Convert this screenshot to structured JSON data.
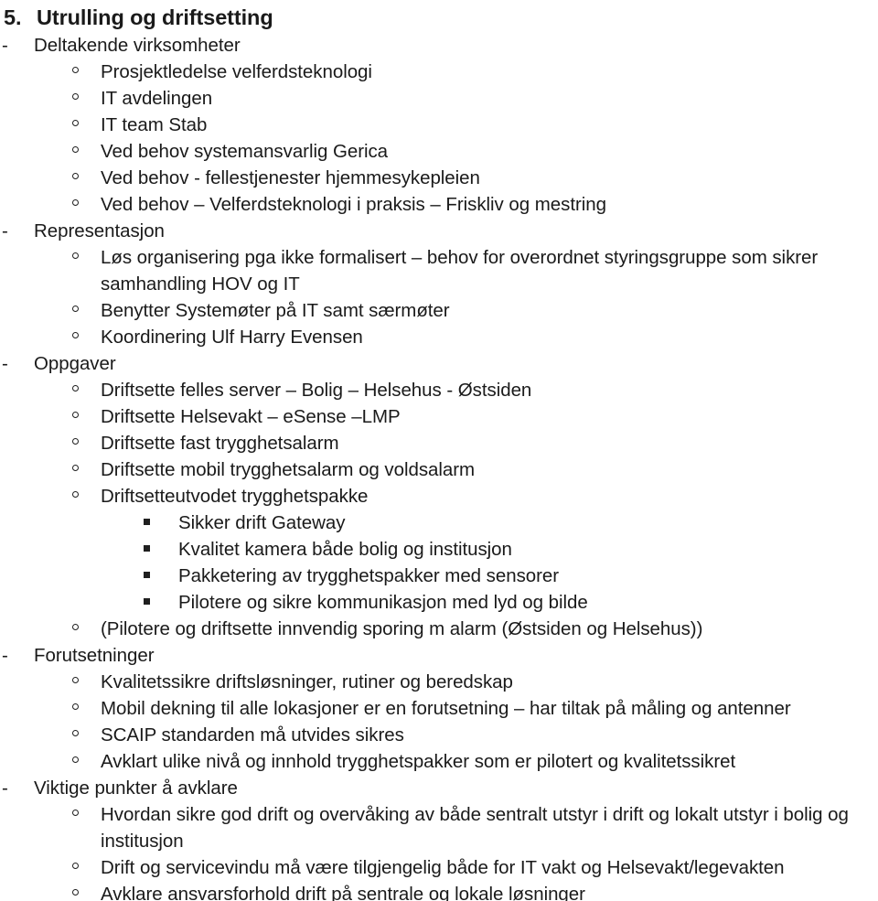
{
  "document": {
    "background_color": "#ffffff",
    "text_color": "#1a1a1a",
    "heading": {
      "number": "5.",
      "title": "Utrulling og driftsetting"
    },
    "markers": {
      "dash": "-",
      "circle": "o",
      "square": "▪"
    },
    "sections": [
      {
        "marker": "dash",
        "label": "Deltakende virksomheter",
        "children": [
          {
            "marker": "circle",
            "label": "Prosjektledelse velferdsteknologi"
          },
          {
            "marker": "circle",
            "label": "IT avdelingen"
          },
          {
            "marker": "circle",
            "label": "IT team Stab"
          },
          {
            "marker": "circle",
            "label": "Ved behov systemansvarlig Gerica"
          },
          {
            "marker": "circle",
            "label": "Ved behov  - fellestjenester hjemmesykepleien"
          },
          {
            "marker": "circle",
            "label": "Ved behov – Velferdsteknologi i praksis – Friskliv og mestring"
          }
        ]
      },
      {
        "marker": "dash",
        "label": "Representasjon",
        "children": [
          {
            "marker": "circle",
            "label": "Løs organisering pga ikke formalisert – behov for overordnet styringsgruppe som sikrer samhandling HOV og IT"
          },
          {
            "marker": "circle",
            "label": "Benytter Systemøter på IT samt særmøter"
          },
          {
            "marker": "circle",
            "label": "Koordinering Ulf Harry Evensen"
          }
        ]
      },
      {
        "marker": "dash",
        "label": "Oppgaver",
        "children": [
          {
            "marker": "circle",
            "label": "Driftsette felles server – Bolig – Helsehus - Østsiden"
          },
          {
            "marker": "circle",
            "label": "Driftsette Helsevakt – eSense –LMP"
          },
          {
            "marker": "circle",
            "label": "Driftsette fast trygghetsalarm"
          },
          {
            "marker": "circle",
            "label": "Driftsette mobil trygghetsalarm og voldsalarm"
          },
          {
            "marker": "circle",
            "label": "Driftsetteutvodet trygghetspakke"
          },
          {
            "marker": "square",
            "label": "Sikker drift Gateway"
          },
          {
            "marker": "square",
            "label": "Kvalitet kamera både bolig og institusjon"
          },
          {
            "marker": "square",
            "label": "Pakketering av trygghetspakker med sensorer"
          },
          {
            "marker": "square",
            "label": "Pilotere og sikre kommunikasjon med lyd og bilde"
          },
          {
            "marker": "circle",
            "label": "(Pilotere og driftsette innvendig sporing m alarm (Østsiden og Helsehus))"
          }
        ]
      },
      {
        "marker": "dash",
        "label": "Forutsetninger",
        "children": [
          {
            "marker": "circle",
            "label": "Kvalitetssikre driftsløsninger, rutiner og beredskap"
          },
          {
            "marker": "circle",
            "label": "Mobil dekning til alle lokasjoner er en forutsetning – har tiltak på måling og antenner"
          },
          {
            "marker": "circle",
            "label": "SCAIP standarden må utvides sikres"
          },
          {
            "marker": "circle",
            "label": "Avklart ulike nivå og innhold trygghetspakker som er pilotert og kvalitetssikret"
          }
        ]
      },
      {
        "marker": "dash",
        "label": "Viktige punkter å avklare",
        "children": [
          {
            "marker": "circle",
            "label": "Hvordan sikre god drift og overvåking av både sentralt utstyr i drift og lokalt utstyr i bolig og institusjon"
          },
          {
            "marker": "circle",
            "label": "Drift og servicevindu må være tilgjengelig både for IT vakt og Helsevakt/legevakten"
          },
          {
            "marker": "circle",
            "label": "Avklare ansvarsforhold drift på sentrale og lokale løsninger"
          }
        ]
      }
    ]
  }
}
